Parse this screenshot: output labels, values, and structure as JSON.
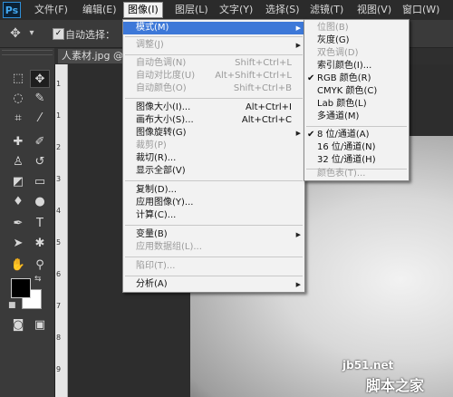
{
  "app": {
    "logo": "Ps"
  },
  "menubar": [
    {
      "label": "文件(F)"
    },
    {
      "label": "编辑(E)"
    },
    {
      "label": "图像(I)"
    },
    {
      "label": "图层(L)"
    },
    {
      "label": "文字(Y)"
    },
    {
      "label": "选择(S)"
    },
    {
      "label": "滤镜(T)"
    },
    {
      "label": "视图(V)"
    },
    {
      "label": "窗口(W)"
    }
  ],
  "options": {
    "move_icon": "✥",
    "dropdown": "▾",
    "autoselect_label": "自动选择：",
    "checked": "✓"
  },
  "tab": {
    "title": "人素材.jpg @"
  },
  "ruler": {
    "marks": [
      "1",
      "1",
      "2",
      "3",
      "4",
      "5",
      "6",
      "7",
      "8",
      "9"
    ]
  },
  "image_menu": [
    {
      "label": "模式(M)",
      "shortcut": "",
      "disabled": false,
      "submenu": true,
      "highlight": true
    },
    {
      "label": "调整(J)",
      "shortcut": "",
      "disabled": true,
      "submenu": true
    },
    {
      "label": "自动色调(N)",
      "shortcut": "Shift+Ctrl+L",
      "disabled": true
    },
    {
      "label": "自动对比度(U)",
      "shortcut": "Alt+Shift+Ctrl+L",
      "disabled": true
    },
    {
      "label": "自动颜色(O)",
      "shortcut": "Shift+Ctrl+B",
      "disabled": true
    },
    {
      "label": "图像大小(I)...",
      "shortcut": "Alt+Ctrl+I",
      "disabled": false
    },
    {
      "label": "画布大小(S)...",
      "shortcut": "Alt+Ctrl+C",
      "disabled": false
    },
    {
      "label": "图像旋转(G)",
      "shortcut": "",
      "disabled": false,
      "submenu": true
    },
    {
      "label": "裁剪(P)",
      "shortcut": "",
      "disabled": true
    },
    {
      "label": "裁切(R)...",
      "shortcut": "",
      "disabled": false
    },
    {
      "label": "显示全部(V)",
      "shortcut": "",
      "disabled": false
    },
    {
      "label": "复制(D)...",
      "shortcut": "",
      "disabled": false
    },
    {
      "label": "应用图像(Y)...",
      "shortcut": "",
      "disabled": false
    },
    {
      "label": "计算(C)...",
      "shortcut": "",
      "disabled": false
    },
    {
      "label": "变量(B)",
      "shortcut": "",
      "disabled": false,
      "submenu": true
    },
    {
      "label": "应用数据组(L)...",
      "shortcut": "",
      "disabled": true
    },
    {
      "label": "陷印(T)...",
      "shortcut": "",
      "disabled": true
    },
    {
      "label": "分析(A)",
      "shortcut": "",
      "disabled": false,
      "submenu": true
    }
  ],
  "mode_menu": [
    {
      "label": "位图(B)",
      "disabled": true,
      "checked": false
    },
    {
      "label": "灰度(G)",
      "disabled": false,
      "checked": false
    },
    {
      "label": "双色调(D)",
      "disabled": true,
      "checked": false
    },
    {
      "label": "索引颜色(I)...",
      "disabled": false,
      "checked": false
    },
    {
      "label": "RGB 颜色(R)",
      "disabled": false,
      "checked": true
    },
    {
      "label": "CMYK 颜色(C)",
      "disabled": false,
      "checked": false
    },
    {
      "label": "Lab 颜色(L)",
      "disabled": false,
      "checked": false
    },
    {
      "label": "多通道(M)",
      "disabled": false,
      "checked": false
    },
    {
      "label": "8 位/通道(A)",
      "disabled": false,
      "checked": true
    },
    {
      "label": "16 位/通道(N)",
      "disabled": false,
      "checked": false
    },
    {
      "label": "32 位/通道(H)",
      "disabled": false,
      "checked": false
    },
    {
      "label": "颜色表(T)...",
      "disabled": true,
      "checked": false
    }
  ],
  "arrow_glyph": "▶",
  "check_glyph": "✔",
  "watermark": {
    "line1": "jb51.net",
    "line2": "脚本之家"
  },
  "colors": {
    "highlight": "#3d78d8",
    "menu_bg": "#f2f2f2",
    "disabled": "#9a9a9a"
  }
}
